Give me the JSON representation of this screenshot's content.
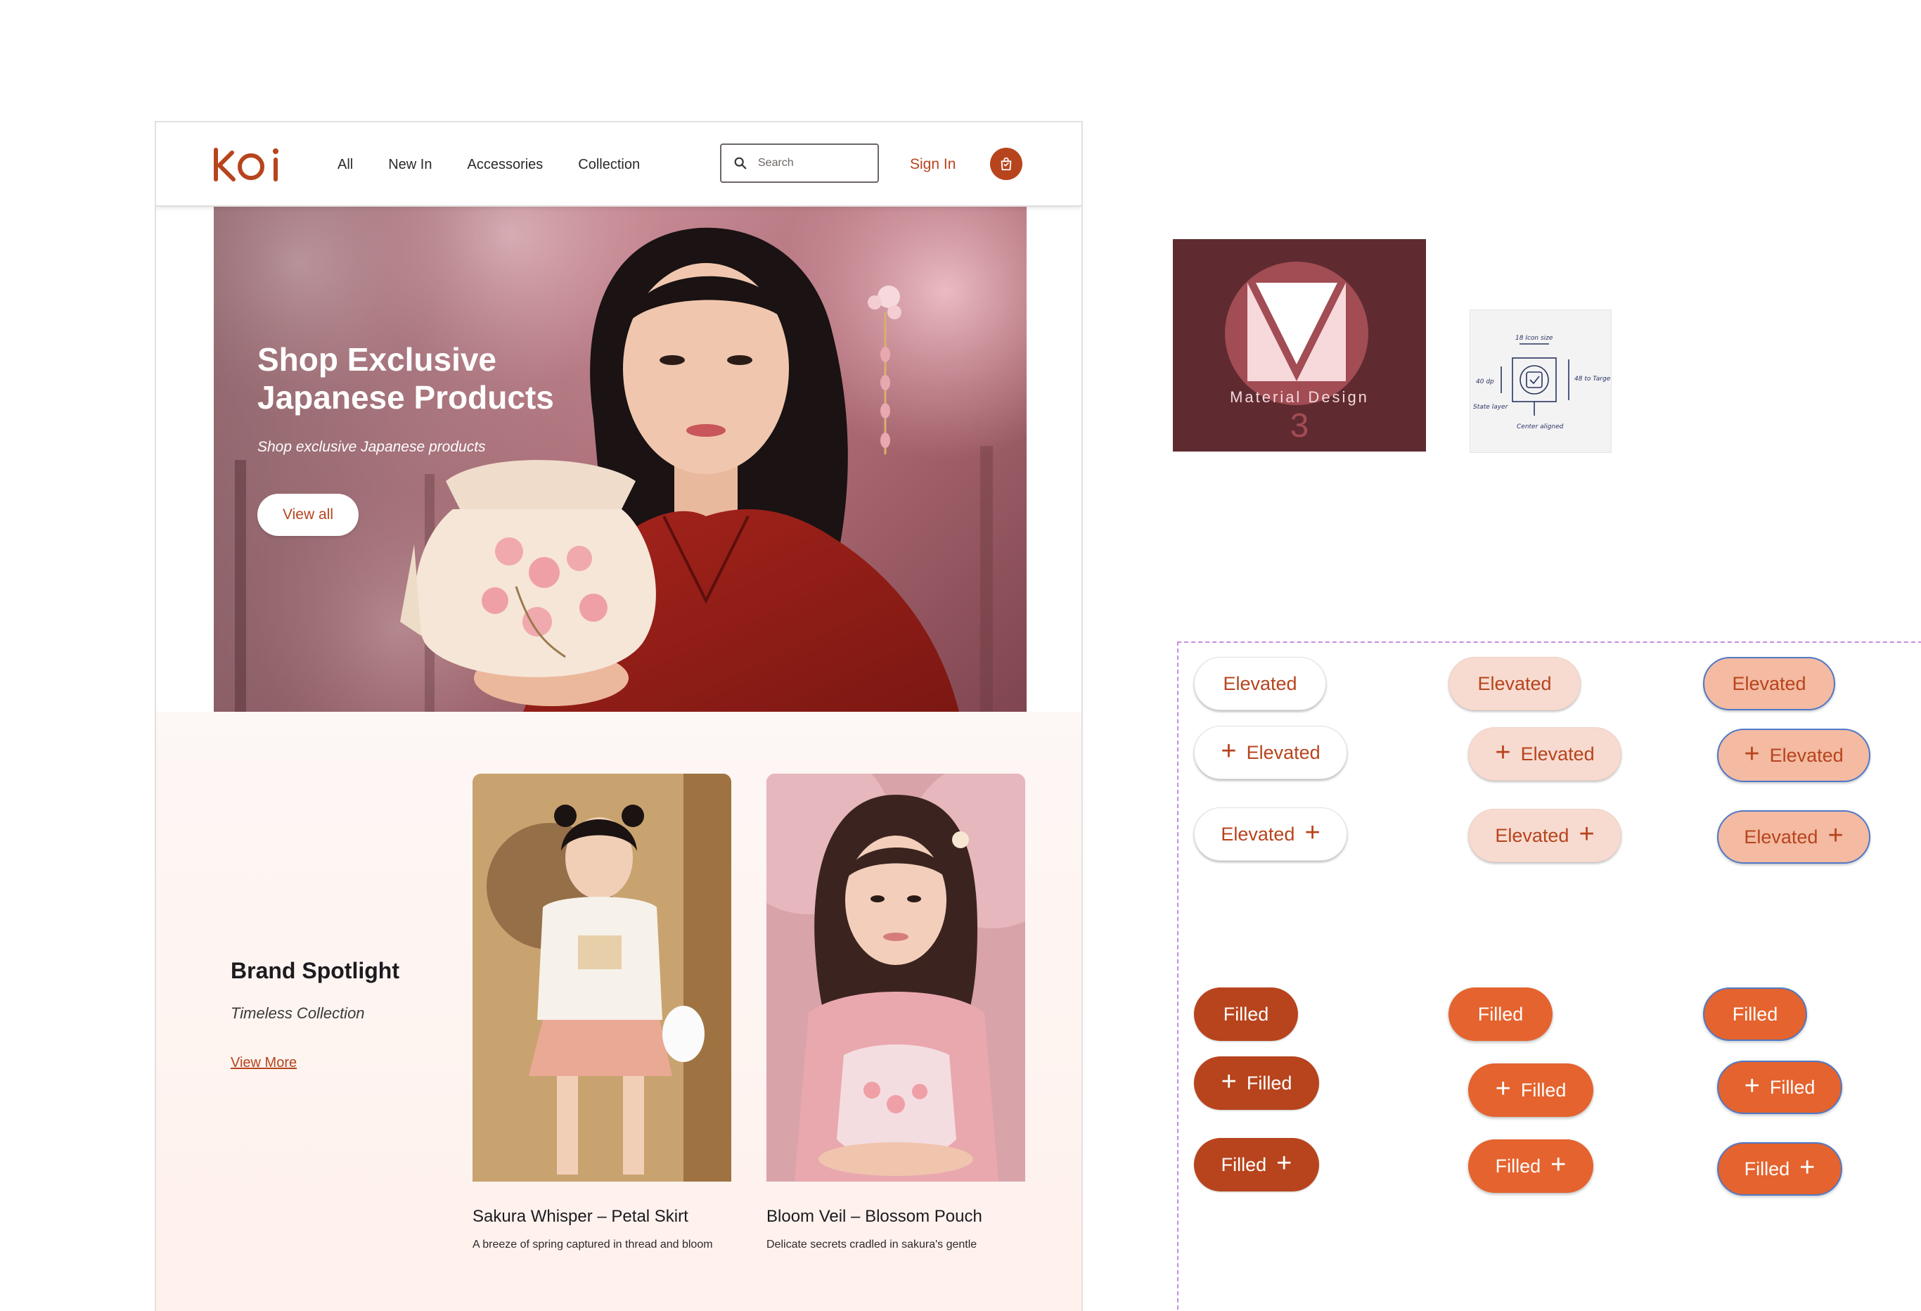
{
  "colors": {
    "brand": "#b7441d",
    "filled_orange": "#e4632e",
    "tonal_peach": "#f7dbd0",
    "material_bg": "#5f2b31"
  },
  "header": {
    "logo": "KOi",
    "nav": [
      "All",
      "New In",
      "Accessories",
      "Collection"
    ],
    "search_placeholder": "Search",
    "sign_in": "Sign In",
    "cart_icon": "shopping-bag-icon"
  },
  "hero": {
    "title": "Shop Exclusive Japanese Products",
    "subtitle": "Shop exclusive Japanese products",
    "button": "View all"
  },
  "spotlight": {
    "title": "Brand Spotlight",
    "subtitle": "Timeless Collection",
    "link": "View More",
    "products": [
      {
        "title": "Sakura Whisper – Petal Skirt",
        "description": "A breeze of spring captured in thread and bloom"
      },
      {
        "title": "Bloom Veil – Blossom Pouch",
        "description": "Delicate secrets cradled in sakura's gentle"
      }
    ]
  },
  "material_tile": {
    "label": "Material Design",
    "number": "3"
  },
  "sketch_labels": {
    "top": "18 Icon size",
    "left": "40 dp",
    "right": "48 to Target size",
    "bottom": "Center aligned",
    "left_bottom": "State layer"
  },
  "buttons": {
    "elevated": "Elevated",
    "filled": "Filled",
    "plus": "+"
  }
}
